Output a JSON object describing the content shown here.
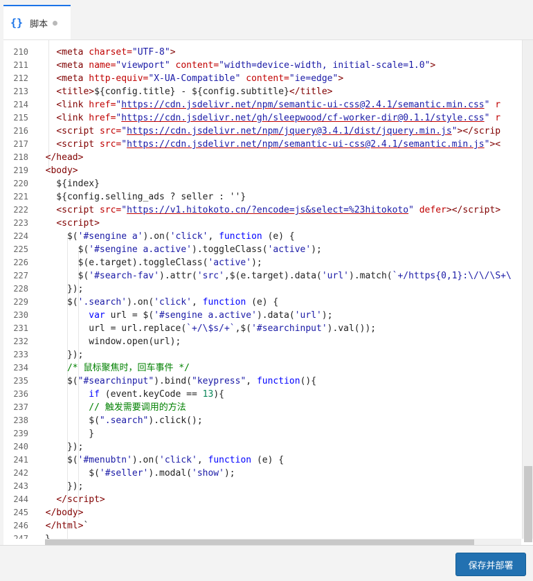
{
  "tab": {
    "icon": "{}",
    "label": "脚本",
    "modified_indicator": "unsaved-dot-icon"
  },
  "editor": {
    "lines": [
      {
        "n": "210",
        "html": "    <span class='tag'>&lt;meta</span> <span class='attr'>charset=</span><span class='str'>\"UTF-8\"</span><span class='tag'>&gt;</span>"
      },
      {
        "n": "211",
        "html": "    <span class='tag'>&lt;meta</span> <span class='attr'>name=</span><span class='str'>\"viewport\"</span> <span class='attr'>content=</span><span class='str'>\"width=device-width, initial-scale=1.0\"</span><span class='tag'>&gt;</span>"
      },
      {
        "n": "212",
        "html": "    <span class='tag'>&lt;meta</span> <span class='attr'>http-equiv=</span><span class='str'>\"X-UA-Compatible\"</span> <span class='attr'>content=</span><span class='str'>\"ie=edge\"</span><span class='tag'>&gt;</span>"
      },
      {
        "n": "213",
        "html": "    <span class='tag'>&lt;title&gt;</span>${config.title} - ${config.subtitle}<span class='tag'>&lt;/title&gt;</span>"
      },
      {
        "n": "214",
        "html": "    <span class='tag'>&lt;link</span> <span class='attr'>href=</span><span class='str'>\"</span><span class='url'>https://cdn.jsdelivr.net/npm/semantic-ui-css@2.4.1/semantic.min.css</span><span class='str'>\"</span> <span class='attr'>r</span>"
      },
      {
        "n": "215",
        "html": "    <span class='tag'>&lt;link</span> <span class='attr'>href=</span><span class='str'>\"</span><span class='url'>https://cdn.jsdelivr.net/gh/sleepwood/cf-worker-dir@0.1.1/style.css</span><span class='str'>\"</span> <span class='attr'>r</span>"
      },
      {
        "n": "216",
        "html": "    <span class='tag'>&lt;script</span> <span class='attr'>src=</span><span class='str'>\"</span><span class='url'>https://cdn.jsdelivr.net/npm/jquery@3.4.1/dist/jquery.min.js</span><span class='str'>\"</span><span class='tag'>&gt;&lt;/scrip</span>"
      },
      {
        "n": "217",
        "html": "    <span class='tag'>&lt;script</span> <span class='attr'>src=</span><span class='str'>\"</span><span class='url'>https://cdn.jsdelivr.net/npm/semantic-ui-css@2.4.1/semantic.min.js</span><span class='str'>\"</span><span class='tag'>&gt;&lt;</span>"
      },
      {
        "n": "218",
        "html": "  <span class='tag'>&lt;/head&gt;</span>"
      },
      {
        "n": "219",
        "html": "  <span class='tag'>&lt;body&gt;</span>"
      },
      {
        "n": "220",
        "html": "    ${index}"
      },
      {
        "n": "221",
        "html": "    ${config.selling_ads ? seller : ''}"
      },
      {
        "n": "222",
        "html": "    <span class='tag'>&lt;script</span> <span class='attr'>src=</span><span class='str'>\"</span><span class='url'>https://v1.hitokoto.cn/?encode=js&amp;select=%23hitokoto</span><span class='str'>\"</span> <span class='attr'>defer</span><span class='tag'>&gt;&lt;/script&gt;</span>"
      },
      {
        "n": "223",
        "html": "    <span class='tag'>&lt;script&gt;</span>"
      },
      {
        "n": "224",
        "html": "      $(<span class='str'>'#sengine a'</span>).on(<span class='str'>'click'</span>, <span class='kw'>function</span> (e) {"
      },
      {
        "n": "225",
        "html": "        $(<span class='str'>'#sengine a.active'</span>).toggleClass(<span class='str'>'active'</span>);"
      },
      {
        "n": "226",
        "html": "        $(e.target).toggleClass(<span class='str'>'active'</span>);"
      },
      {
        "n": "227",
        "html": "        $(<span class='str'>'#search-fav'</span>).attr(<span class='str'>'src'</span>,$(e.target).data(<span class='str'>'url'</span>).match(<span class='str'>`+/https{0,1}:\\/\\/\\S+\\</span>"
      },
      {
        "n": "228",
        "html": "      });"
      },
      {
        "n": "229",
        "html": "      $(<span class='str'>'.search'</span>).on(<span class='str'>'click'</span>, <span class='kw'>function</span> (e) {"
      },
      {
        "n": "230",
        "html": "          <span class='kw'>var</span> url = $(<span class='str'>'#sengine a.active'</span>).data(<span class='str'>'url'</span>);"
      },
      {
        "n": "231",
        "html": "          url = url.replace(<span class='str'>`+/\\$s/+`</span>,$(<span class='str'>'#searchinput'</span>).val());"
      },
      {
        "n": "232",
        "html": "          window.open(url);"
      },
      {
        "n": "233",
        "html": "      });"
      },
      {
        "n": "234",
        "html": "      <span class='com'>/* 鼠标聚焦时，回车事件 */</span>"
      },
      {
        "n": "235",
        "html": "      $(<span class='str'>\"#searchinput\"</span>).bind(<span class='str'>\"keypress\"</span>, <span class='kw'>function</span>(){"
      },
      {
        "n": "236",
        "html": "          <span class='kw'>if</span> (event.keyCode == <span class='num'>13</span>){"
      },
      {
        "n": "237",
        "html": "          <span class='com'>// 触发需要调用的方法</span>"
      },
      {
        "n": "238",
        "html": "          $(<span class='str'>\".search\"</span>).click();"
      },
      {
        "n": "239",
        "html": "          }"
      },
      {
        "n": "240",
        "html": "      });"
      },
      {
        "n": "241",
        "html": "      $(<span class='str'>'#menubtn'</span>).on(<span class='str'>'click'</span>, <span class='kw'>function</span> (e) {"
      },
      {
        "n": "242",
        "html": "          $(<span class='str'>'#seller'</span>).modal(<span class='str'>'show'</span>);"
      },
      {
        "n": "243",
        "html": "      });"
      },
      {
        "n": "244",
        "html": "    <span class='tag'>&lt;/script&gt;</span>"
      },
      {
        "n": "245",
        "html": "  <span class='tag'>&lt;/body&gt;</span>"
      },
      {
        "n": "246",
        "html": "  <span class='tag'>&lt;/html&gt;</span>`"
      },
      {
        "n": "247",
        "html": ""
      }
    ],
    "last_line_char": "}"
  },
  "footer": {
    "deploy_label": "保存并部署"
  }
}
